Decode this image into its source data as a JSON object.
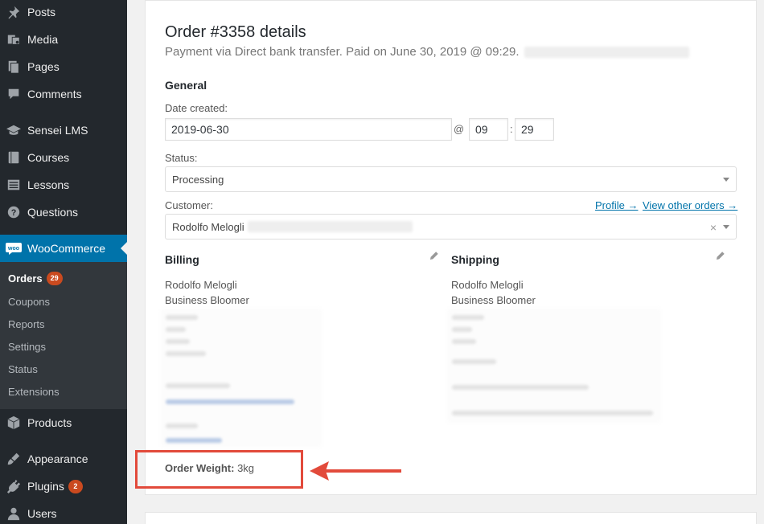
{
  "sidebar": {
    "items": [
      {
        "label": "Posts",
        "icon": "pin-icon"
      },
      {
        "label": "Media",
        "icon": "media-icon"
      },
      {
        "label": "Pages",
        "icon": "pages-icon"
      },
      {
        "label": "Comments",
        "icon": "comment-icon"
      },
      {
        "label": "Sensei LMS",
        "icon": "graduation-cap-icon"
      },
      {
        "label": "Courses",
        "icon": "book-icon"
      },
      {
        "label": "Lessons",
        "icon": "list-icon"
      },
      {
        "label": "Questions",
        "icon": "question-icon"
      },
      {
        "label": "WooCommerce",
        "icon": "woo-icon"
      },
      {
        "label": "Products",
        "icon": "box-icon"
      },
      {
        "label": "Appearance",
        "icon": "brush-icon"
      },
      {
        "label": "Plugins",
        "icon": "plugin-icon",
        "badge": "2"
      },
      {
        "label": "Users",
        "icon": "user-icon"
      }
    ],
    "woo_submenu": [
      {
        "label": "Orders",
        "badge": "29"
      },
      {
        "label": "Coupons"
      },
      {
        "label": "Reports"
      },
      {
        "label": "Settings"
      },
      {
        "label": "Status"
      },
      {
        "label": "Extensions"
      }
    ],
    "woo_icon_text": "woo"
  },
  "order": {
    "title": "Order #3358 details",
    "subtitle": "Payment via Direct bank transfer. Paid on June 30, 2019 @ 09:29.",
    "general_heading": "General",
    "date_label": "Date created:",
    "date_value": "2019-06-30",
    "at_symbol": "@",
    "hour_value": "09",
    "colon": ":",
    "minute_value": "29",
    "status_label": "Status:",
    "status_value": "Processing",
    "customer_label": "Customer:",
    "profile_link": "Profile →",
    "other_orders_link": "View other orders →",
    "customer_value": "Rodolfo Melogli",
    "clear_symbol": "×",
    "billing_heading": "Billing",
    "shipping_heading": "Shipping",
    "billing_name": "Rodolfo Melogli",
    "billing_company": "Business Bloomer",
    "shipping_name": "Rodolfo Melogli",
    "shipping_company": "Business Bloomer",
    "weight_label": "Order Weight:",
    "weight_value": "3kg"
  },
  "colors": {
    "sidebar_bg": "#23282d",
    "active_bg": "#0073aa",
    "badge": "#ca4a1f",
    "highlight": "#e24a3b",
    "link": "#0073aa"
  }
}
